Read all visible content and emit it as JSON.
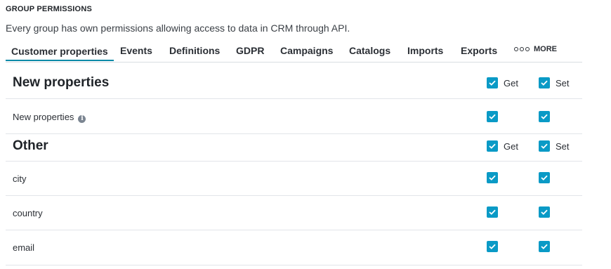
{
  "header": {
    "section_title": "GROUP PERMISSIONS",
    "description": "Every group has own permissions allowing access to data in CRM through API."
  },
  "tabs": [
    {
      "label": "Customer properties",
      "active": true
    },
    {
      "label": "Events"
    },
    {
      "label": "Definitions"
    },
    {
      "label": "GDPR"
    },
    {
      "label": "Campaigns"
    },
    {
      "label": "Catalogs"
    },
    {
      "label": "Imports"
    },
    {
      "label": "Exports"
    }
  ],
  "more_label": "MORE",
  "permissions": {
    "get_label": "Get",
    "set_label": "Set",
    "groups": [
      {
        "heading": "New properties",
        "get": true,
        "set": true,
        "items": [
          {
            "name": "New properties",
            "info_icon": "info-icon",
            "get": true,
            "set": true
          }
        ]
      },
      {
        "heading": "Other",
        "get": true,
        "set": true,
        "items": [
          {
            "name": "city",
            "get": true,
            "set": true
          },
          {
            "name": "country",
            "get": true,
            "set": true
          },
          {
            "name": "email",
            "get": true,
            "set": true
          }
        ]
      }
    ]
  },
  "colors": {
    "accent": "#0a9ac6",
    "tab_underline": "#0a8aa8"
  }
}
